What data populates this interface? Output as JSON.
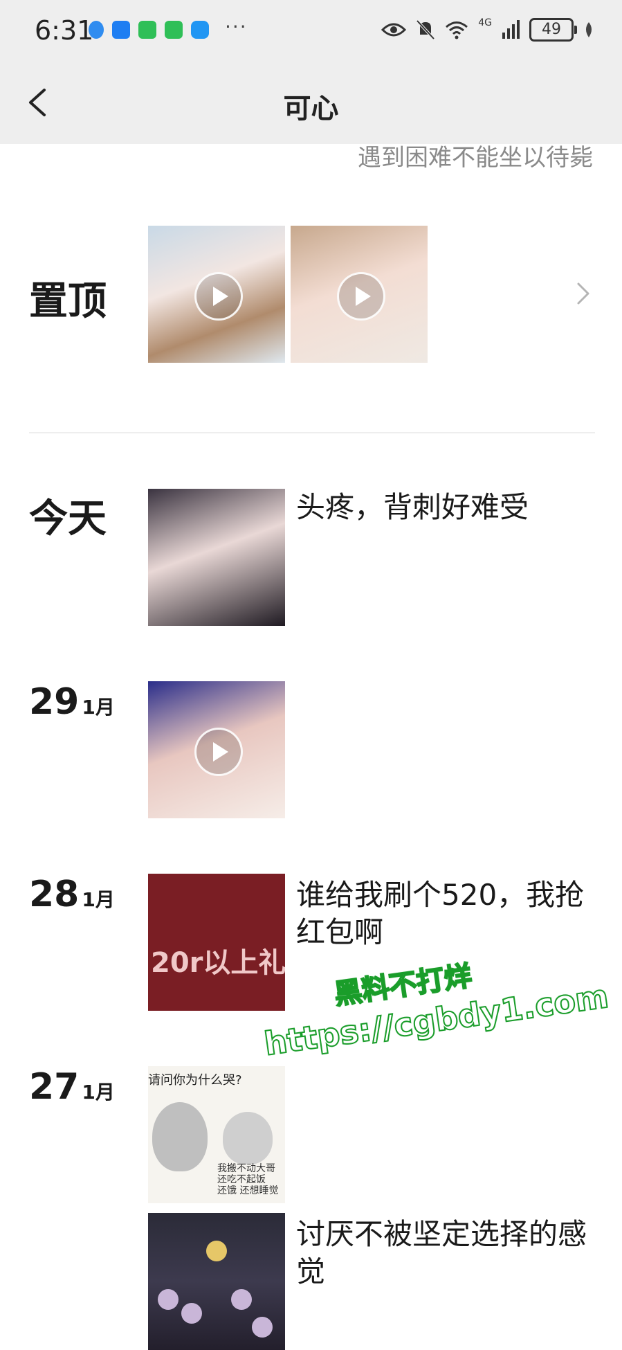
{
  "status_bar": {
    "time": "6:31",
    "network": "4G",
    "battery": "49",
    "icons": [
      "shield-icon",
      "check-shield-icon",
      "app-icon",
      "app-icon",
      "chat-icon",
      "more-icon",
      "eye-icon",
      "mute-icon",
      "wifi-icon",
      "signal-icon",
      "battery-icon",
      "leaf-icon"
    ]
  },
  "header": {
    "title": "可心",
    "signature": "遇到困难不能坐以待毙"
  },
  "sections": {
    "pinned": {
      "label": "置顶"
    },
    "today": {
      "label": "今天",
      "caption": "头疼，背刺好难受"
    },
    "d29": {
      "day": "29",
      "month": "1月"
    },
    "d28": {
      "day": "28",
      "month": "1月",
      "caption": "谁给我刷个520，我抢红包啊",
      "thumb_text": "20r以上礼"
    },
    "d27": {
      "day": "27",
      "month": "1月",
      "meme_top": "请问你为什么哭?",
      "meme_bottom": "我搬不动大哥\n还吃不起饭\n还饿 还想睡觉",
      "caption": "讨厌不被坚定选择的感觉"
    }
  },
  "watermark": {
    "line1": "黑料不打烊",
    "line2": "https://cgbdy1.com"
  },
  "colors": {
    "bar_bg": "#eeeeee",
    "text": "#1a1a1a",
    "muted": "#8a8a8a",
    "watermark": "#1a9d2a"
  }
}
